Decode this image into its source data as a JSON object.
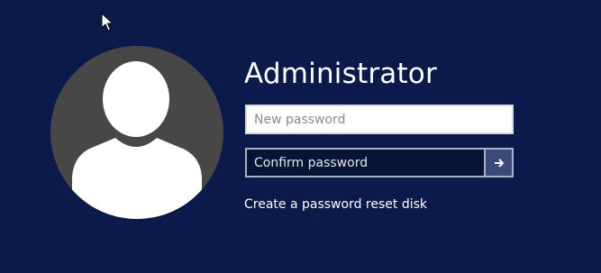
{
  "account": {
    "username": "Administrator"
  },
  "form": {
    "new_password": {
      "value": "",
      "placeholder": "New password"
    },
    "confirm_password": {
      "value": "",
      "placeholder": "Confirm password"
    },
    "submit_icon": "arrow-right-icon"
  },
  "links": {
    "reset_disk": "Create a password reset disk"
  },
  "colors": {
    "background": "#0b1a4a",
    "avatar_bg": "#474747",
    "submit_bg": "#3b4a78"
  },
  "icons": {
    "cursor": "mouse-pointer-icon",
    "avatar": "user-silhouette-icon"
  }
}
